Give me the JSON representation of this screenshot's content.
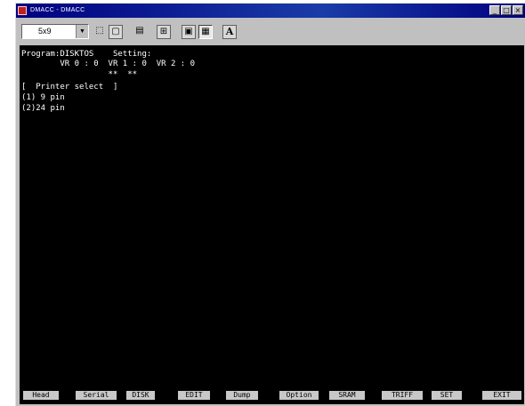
{
  "window": {
    "title": "DMACC - DMACC",
    "min_glyph": "_",
    "max_glyph": "□",
    "close_glyph": "×"
  },
  "toolbar": {
    "font_size": "5x9",
    "dropdown_glyph": "▼",
    "tools": [
      {
        "name": "select-icon",
        "glyph": "⬚"
      },
      {
        "name": "copy-icon",
        "glyph": "▢"
      },
      {
        "name": "paste-icon",
        "glyph": "▤"
      },
      {
        "name": "fullscreen-icon",
        "glyph": "⊞"
      },
      {
        "name": "background-icon",
        "glyph": "▣"
      },
      {
        "name": "properties-icon",
        "glyph": "▦"
      },
      {
        "name": "font-icon",
        "glyph": "A"
      }
    ]
  },
  "screen": {
    "lines": [
      "Program:DISKTOS    Setting:",
      "        VR 0 : 0  VR 1 : 0  VR 2 : 0",
      "                  **  **",
      "[  Printer select  ]",
      "(1) 9 pin",
      "(2)24 pin"
    ]
  },
  "function_keys": [
    "Head",
    "Serial",
    "DISK",
    "EDIT",
    "Dump",
    "Option",
    "SRAM",
    "TRIFF",
    "SET",
    "EXIT"
  ]
}
